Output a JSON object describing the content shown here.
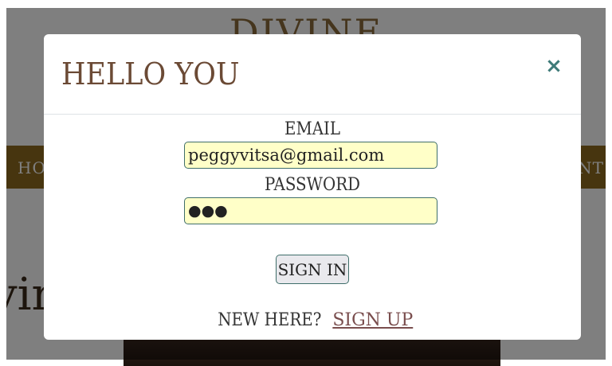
{
  "background": {
    "logo": "DIVINE",
    "nav_left": "HO",
    "nav_right": "NT",
    "hero_text": "vir"
  },
  "modal": {
    "title": "HELLO YOU",
    "close_icon": "close-icon",
    "close_glyph": "×"
  },
  "form": {
    "email_label": "EMAIL",
    "email_value": "peggyvitsa@gmail.com",
    "password_label": "PASSWORD",
    "password_value": "●●●",
    "signin_label": "SIGN IN",
    "signup_prompt": "NEW HERE?",
    "signup_link": "SIGN UP"
  },
  "colors": {
    "nav_bg": "#8e6a1f",
    "field_bg": "#ffffc8",
    "accent": "#3e7a78",
    "title": "#6b4a35"
  }
}
